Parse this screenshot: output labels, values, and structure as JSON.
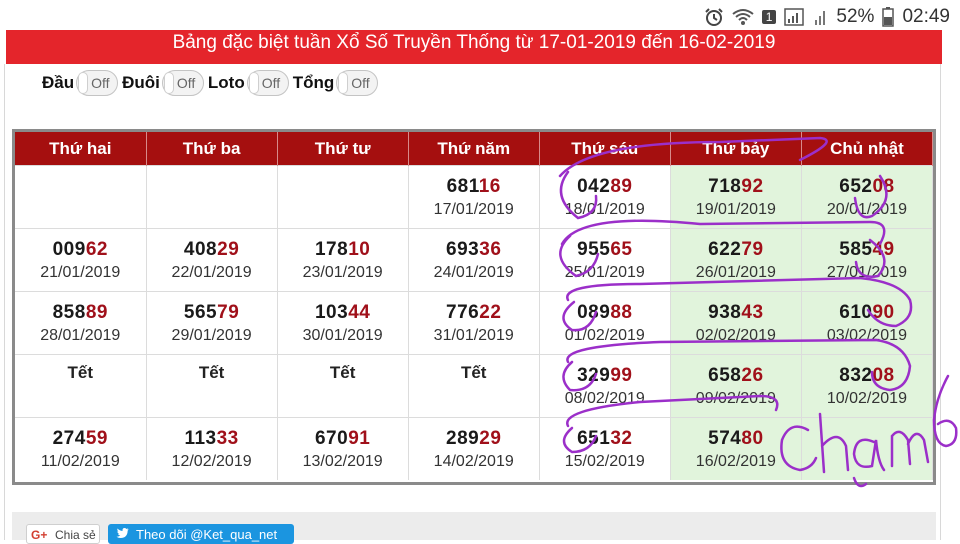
{
  "status_bar": {
    "battery": "52%",
    "time": "02:49",
    "notification_count": "1"
  },
  "banner": {
    "title": "Bảng đặc biệt tuần Xổ Số Truyền Thống từ 17-01-2019 đến 16-02-2019"
  },
  "toggles": [
    {
      "label": "Đầu",
      "state": "Off"
    },
    {
      "label": "Đuôi",
      "state": "Off"
    },
    {
      "label": "Loto",
      "state": "Off"
    },
    {
      "label": "Tổng",
      "state": "Off"
    }
  ],
  "table": {
    "headers": [
      "Thứ hai",
      "Thứ ba",
      "Thứ tư",
      "Thứ năm",
      "Thứ sáu",
      "Thứ bảy",
      "Chủ nhật"
    ],
    "rows": [
      [
        {
          "empty": true
        },
        {
          "empty": true
        },
        {
          "empty": true
        },
        {
          "head": "681",
          "tail": "16",
          "date": "17/01/2019"
        },
        {
          "head": "042",
          "tail": "89",
          "date": "18/01/2019"
        },
        {
          "head": "718",
          "tail": "92",
          "date": "19/01/2019"
        },
        {
          "head": "652",
          "tail": "08",
          "date": "20/01/2019"
        }
      ],
      [
        {
          "head": "009",
          "tail": "62",
          "date": "21/01/2019"
        },
        {
          "head": "408",
          "tail": "29",
          "date": "22/01/2019"
        },
        {
          "head": "178",
          "tail": "10",
          "date": "23/01/2019"
        },
        {
          "head": "693",
          "tail": "36",
          "date": "24/01/2019"
        },
        {
          "head": "955",
          "tail": "65",
          "date": "25/01/2019"
        },
        {
          "head": "622",
          "tail": "79",
          "date": "26/01/2019"
        },
        {
          "head": "585",
          "tail": "49",
          "date": "27/01/2019"
        }
      ],
      [
        {
          "head": "858",
          "tail": "89",
          "date": "28/01/2019"
        },
        {
          "head": "565",
          "tail": "79",
          "date": "29/01/2019"
        },
        {
          "head": "103",
          "tail": "44",
          "date": "30/01/2019"
        },
        {
          "head": "776",
          "tail": "22",
          "date": "31/01/2019"
        },
        {
          "head": "089",
          "tail": "88",
          "date": "01/02/2019"
        },
        {
          "head": "938",
          "tail": "43",
          "date": "02/02/2019"
        },
        {
          "head": "610",
          "tail": "90",
          "date": "03/02/2019"
        }
      ],
      [
        {
          "tet": "Tết"
        },
        {
          "tet": "Tết"
        },
        {
          "tet": "Tết"
        },
        {
          "tet": "Tết"
        },
        {
          "head": "329",
          "tail": "99",
          "date": "08/02/2019"
        },
        {
          "head": "658",
          "tail": "26",
          "date": "09/02/2019"
        },
        {
          "head": "832",
          "tail": "08",
          "date": "10/02/2019"
        }
      ],
      [
        {
          "head": "274",
          "tail": "59",
          "date": "11/02/2019"
        },
        {
          "head": "113",
          "tail": "33",
          "date": "12/02/2019"
        },
        {
          "head": "670",
          "tail": "91",
          "date": "13/02/2019"
        },
        {
          "head": "289",
          "tail": "29",
          "date": "14/02/2019"
        },
        {
          "head": "651",
          "tail": "32",
          "date": "15/02/2019"
        },
        {
          "head": "574",
          "tail": "80",
          "date": "16/02/2019"
        },
        {
          "empty": true
        }
      ]
    ]
  },
  "footer": {
    "share_label": "Chia sẻ",
    "follow_label": "Theo dõi @Ket_qua_net"
  },
  "annotation": {
    "handwritten_text": "chạm 6",
    "ink_color": "#9b2fc9"
  },
  "colors": {
    "banner": "#e4252b",
    "header": "#a50f0f",
    "weekend_bg": "#e1f4dc",
    "tail_digits": "#a0101a"
  }
}
